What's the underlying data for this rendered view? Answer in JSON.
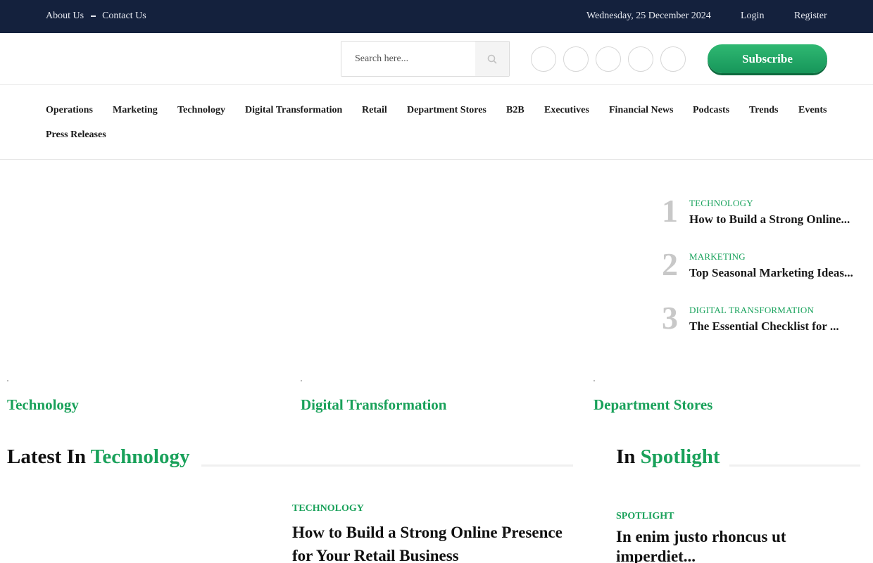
{
  "topbar": {
    "links": [
      "About Us",
      "Contact Us"
    ],
    "date": "Wednesday, 25 December 2024",
    "login": "Login",
    "register": "Register"
  },
  "header": {
    "search_placeholder": "Search here...",
    "social_icons": [
      "facebook-icon",
      "twitter-icon",
      "linkedin-icon",
      "instagram-icon",
      "youtube-icon"
    ],
    "subscribe": "Subscribe"
  },
  "nav": {
    "items": [
      "Operations",
      "Marketing",
      "Technology",
      "Digital Transformation",
      "Retail",
      "Department Stores",
      "B2B",
      "Executives",
      "Financial News",
      "Podcasts",
      "Trends",
      "Events",
      "Press Releases"
    ]
  },
  "trending": [
    {
      "num": "1",
      "category": "TECHNOLOGY",
      "title": "How to Build a Strong Online..."
    },
    {
      "num": "2",
      "category": "MARKETING",
      "title": "Top Seasonal Marketing Ideas..."
    },
    {
      "num": "3",
      "category": "DIGITAL TRANSFORMATION",
      "title": "The Essential Checklist for ..."
    }
  ],
  "tiles": [
    "Technology",
    "Digital Transformation",
    "Department Stores"
  ],
  "latest": {
    "heading_prefix": "Latest In",
    "heading_accent": "Technology",
    "category": "TECHNOLOGY",
    "title": "How to Build a Strong Online Presence for Your Retail Business"
  },
  "spotlight": {
    "heading_prefix": "In",
    "heading_accent": "Spotlight",
    "category": "SPOTLIGHT",
    "title": "In enim justo rhoncus ut imperdiet..."
  },
  "colors": {
    "topbar": "#14213d",
    "accent": "#19a15a"
  }
}
